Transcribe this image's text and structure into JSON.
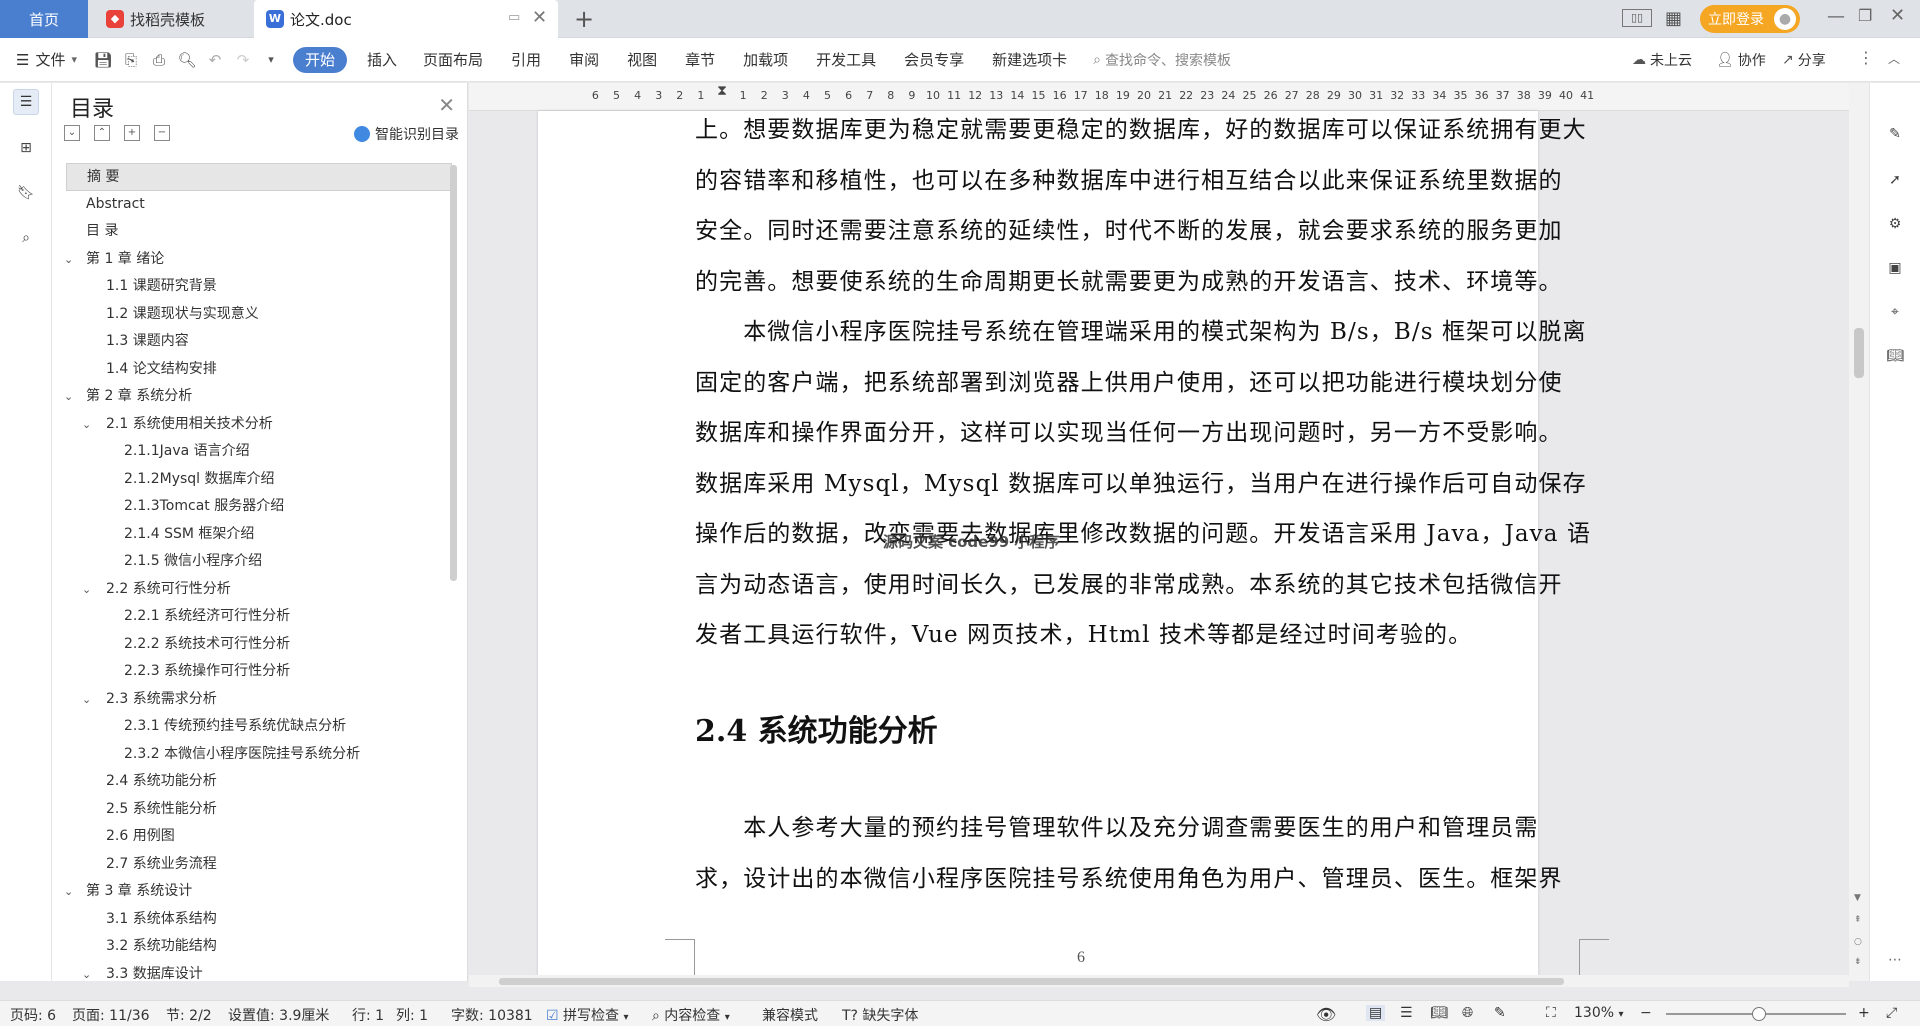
{
  "tabs": {
    "home": "首页",
    "template": "找稻壳模板",
    "document": "论文.doc"
  },
  "topright": {
    "login": "立即登录"
  },
  "ribbon": {
    "file": "文件",
    "menus": [
      "开始",
      "插入",
      "页面布局",
      "引用",
      "审阅",
      "视图",
      "章节",
      "加载项",
      "开发工具",
      "会员专享",
      "新建选项卡"
    ],
    "search_placeholder": "查找命令、搜索模板",
    "cloud": "未上云",
    "collab": "协作",
    "share": "分享"
  },
  "toc": {
    "title": "目录",
    "smart": "智能识别目录",
    "items": [
      {
        "text": "摘  要",
        "level": 0,
        "selected": true
      },
      {
        "text": "Abstract",
        "level": 0
      },
      {
        "text": "目  录",
        "level": 0
      },
      {
        "text": "第 1 章   绪论",
        "level": 0,
        "expanded": true
      },
      {
        "text": "1.1 课题研究背景",
        "level": 1
      },
      {
        "text": "1.2 课题现状与实现意义",
        "level": 1
      },
      {
        "text": "1.3 课题内容",
        "level": 1
      },
      {
        "text": "1.4 论文结构安排",
        "level": 1
      },
      {
        "text": "第 2 章   系统分析",
        "level": 0,
        "expanded": true
      },
      {
        "text": "2.1 系统使用相关技术分析",
        "level": 1,
        "expanded": true
      },
      {
        "text": "2.1.1Java 语言介绍",
        "level": 2
      },
      {
        "text": "2.1.2Mysql 数据库介绍",
        "level": 2
      },
      {
        "text": "2.1.3Tomcat 服务器介绍",
        "level": 2
      },
      {
        "text": "2.1.4 SSM 框架介绍",
        "level": 2
      },
      {
        "text": "2.1.5 微信小程序介绍",
        "level": 2
      },
      {
        "text": "2.2 系统可行性分析",
        "level": 1,
        "expanded": true
      },
      {
        "text": "2.2.1 系统经济可行性分析",
        "level": 2
      },
      {
        "text": "2.2.2 系统技术可行性分析",
        "level": 2
      },
      {
        "text": "2.2.3 系统操作可行性分析",
        "level": 2
      },
      {
        "text": "2.3 系统需求分析",
        "level": 1,
        "expanded": true
      },
      {
        "text": "2.3.1 传统预约挂号系统优缺点分析",
        "level": 2
      },
      {
        "text": "2.3.2 本微信小程序医院挂号系统分析",
        "level": 2
      },
      {
        "text": "2.4 系统功能分析",
        "level": 1
      },
      {
        "text": "2.5 系统性能分析",
        "level": 1
      },
      {
        "text": "2.6 用例图",
        "level": 1
      },
      {
        "text": "2.7 系统业务流程",
        "level": 1
      },
      {
        "text": "第 3 章   系统设计",
        "level": 0,
        "expanded": true
      },
      {
        "text": "3.1 系统体系结构",
        "level": 1
      },
      {
        "text": "3.2 系统功能结构",
        "level": 1
      },
      {
        "text": "3.3 数据库设计",
        "level": 1,
        "expanded": true
      }
    ]
  },
  "ruler": {
    "left_ticks": [
      "6",
      "5",
      "4",
      "3",
      "2",
      "1"
    ],
    "right_ticks": [
      "1",
      "2",
      "3",
      "4",
      "5",
      "6",
      "7",
      "8",
      "9",
      "10",
      "11",
      "12",
      "13",
      "14",
      "15",
      "16",
      "17",
      "18",
      "19",
      "20",
      "21",
      "22",
      "23",
      "24",
      "25",
      "26",
      "27",
      "28",
      "29",
      "30",
      "31",
      "32",
      "33",
      "34",
      "35",
      "36",
      "37",
      "38",
      "39",
      "40",
      "41"
    ]
  },
  "document": {
    "lines": [
      "上。想要数据库更为稳定就需要更稳定的数据库，好的数据库可以保证系统拥有更大",
      "的容错率和移植性，也可以在多种数据库中进行相互结合以此来保证系统里数据的",
      "安全。同时还需要注意系统的延续性，时代不断的发展，就会要求系统的服务更加",
      "的完善。想要使系统的生命周期更长就需要更为成熟的开发语言、技术、环境等。",
      "　　本微信小程序医院挂号系统在管理端采用的模式架构为 B/s，B/s 框架可以脱离",
      "固定的客户端，把系统部署到浏览器上供用户使用，还可以把功能进行模块划分使",
      "数据库和操作界面分开，这样可以实现当任何一方出现问题时，另一方不受影响。",
      "数据库采用 Mysql，Mysql 数据库可以单独运行，当用户在进行操作后可自动保存",
      "操作后的数据，改变需要去数据库里修改数据的问题。开发语言采用 Java，Java 语",
      "言为动态语言，使用时间长久，已发展的非常成熟。本系统的其它技术包括微信开",
      "发者工具运行软件，Vue 网页技术，Html 技术等都是经过时间考验的。"
    ],
    "heading": "2.4 系统功能分析",
    "lines2": [
      "　　本人参考大量的预约挂号管理软件以及充分调查需要医生的用户和管理员需",
      "求，设计出的本微信小程序医院挂号系统使用角色为用户、管理员、医生。框架界"
    ],
    "watermark": "源码文案 code99 小程序",
    "page_number": "6"
  },
  "status": {
    "page_code": "页码: 6",
    "page": "页面: 11/36",
    "section": "节: 2/2",
    "setting": "设置值: 3.9厘米",
    "row": "行: 1",
    "col": "列: 1",
    "words": "字数: 10381",
    "spell": "拼写检查",
    "content_check": "内容检查",
    "compat": "兼容模式",
    "missing_font": "缺失字体",
    "zoom": "130%"
  },
  "colors": {
    "accent": "#4a7fd0",
    "login": "#f5a623"
  }
}
